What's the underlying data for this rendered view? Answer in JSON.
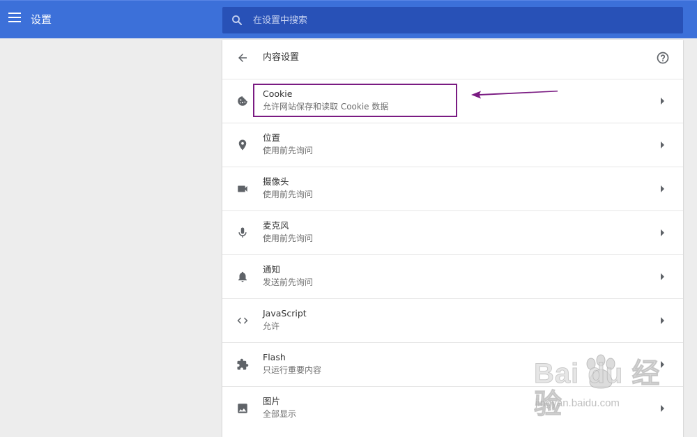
{
  "app": {
    "title": "设置"
  },
  "search": {
    "placeholder": "在设置中搜索",
    "value": ""
  },
  "page": {
    "title": "内容设置"
  },
  "icons": {
    "menu": "hamburger-icon",
    "search": "search-icon",
    "back": "arrow-back-icon",
    "help": "help-circle-icon",
    "chevron": "chevron-right-icon"
  },
  "settings": [
    {
      "title": "Cookie",
      "subtitle": "允许网站保存和读取 Cookie 数据",
      "icon": "cookie-icon"
    },
    {
      "title": "位置",
      "subtitle": "使用前先询问",
      "icon": "location-pin-icon"
    },
    {
      "title": "摄像头",
      "subtitle": "使用前先询问",
      "icon": "videocam-icon"
    },
    {
      "title": "麦克风",
      "subtitle": "使用前先询问",
      "icon": "mic-icon"
    },
    {
      "title": "通知",
      "subtitle": "发送前先询问",
      "icon": "bell-icon"
    },
    {
      "title": "JavaScript",
      "subtitle": "允许",
      "icon": "code-icon"
    },
    {
      "title": "Flash",
      "subtitle": "只运行重要内容",
      "icon": "puzzle-icon"
    },
    {
      "title": "图片",
      "subtitle": "全部显示",
      "icon": "image-icon"
    }
  ],
  "annotation": {
    "color": "#7a1b82"
  },
  "watermark": {
    "logo": "Bai du 经验",
    "url": "jingyan.baidu.com"
  },
  "colors": {
    "topbar": "#3c70d9",
    "search_bg": "#2851b7",
    "page_bg": "#ededed",
    "icon": "#5f6368"
  }
}
